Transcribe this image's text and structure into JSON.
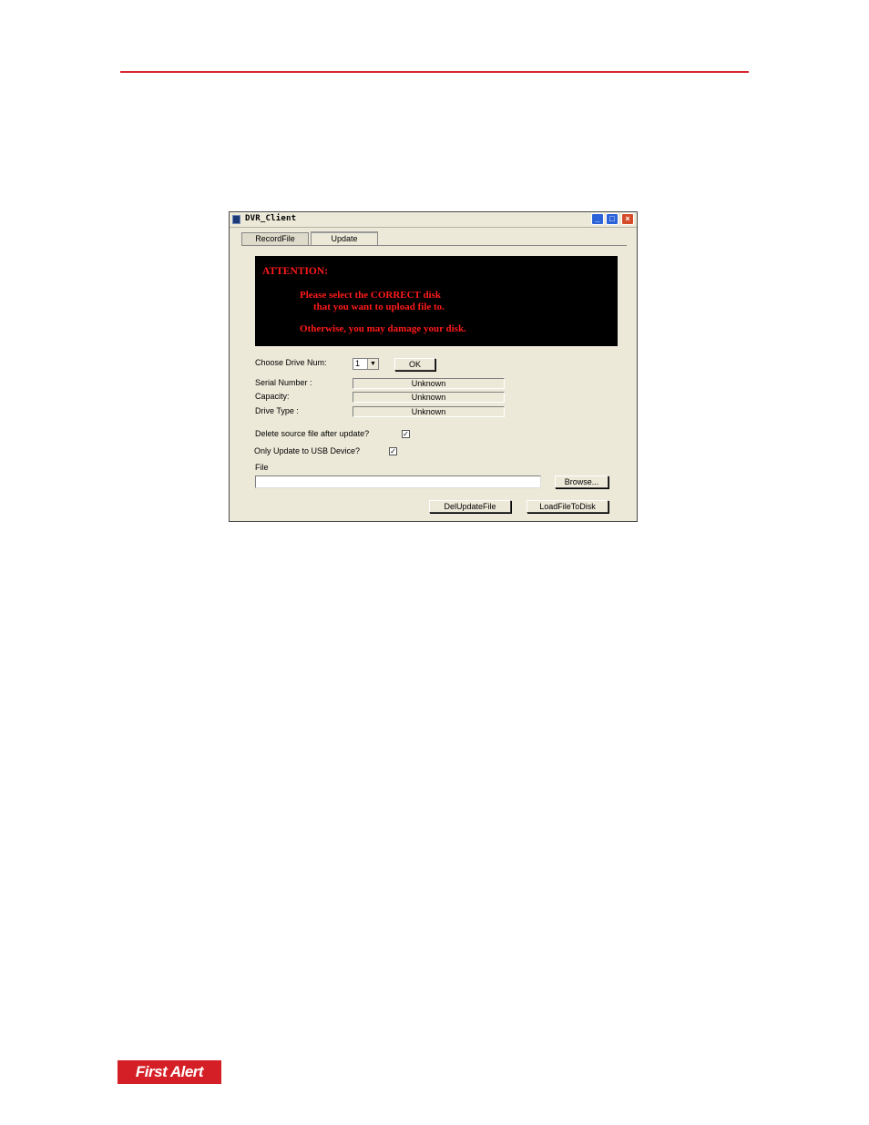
{
  "window": {
    "title": "DVR_Client",
    "controls": {
      "minimize": "_",
      "maximize": "□",
      "close": "×"
    }
  },
  "tabs": [
    {
      "label": "RecordFile",
      "active": false
    },
    {
      "label": "Update",
      "active": true
    }
  ],
  "attention": {
    "title": "ATTENTION:",
    "line1": "Please select the CORRECT disk",
    "line2": "that you want to upload file to.",
    "line3": "Otherwise, you may damage your disk.",
    "text_color": "#ff1a1a",
    "background": "#000000"
  },
  "drive": {
    "label": "Choose Drive Num:",
    "selected": "1",
    "ok_label": "OK"
  },
  "info": [
    {
      "label": "Serial Number :",
      "value": "Unknown"
    },
    {
      "label": "Capacity:",
      "value": "Unknown"
    },
    {
      "label": "Drive Type :",
      "value": "Unknown"
    }
  ],
  "options": {
    "delete_source": {
      "label": "Delete source file after update?",
      "checked": true,
      "mark": "✓"
    },
    "usb_only": {
      "label": "Only Update to USB Device?",
      "checked": true,
      "mark": "✓"
    }
  },
  "file": {
    "label": "File",
    "value": "",
    "browse_label": "Browse..."
  },
  "actions": {
    "del_label": "DelUpdateFile",
    "load_label": "LoadFileToDisk"
  },
  "footer": {
    "logo_text": "First Alert"
  },
  "colors": {
    "accent_rule": "#d8262e",
    "logo_red": "#d51f26"
  }
}
